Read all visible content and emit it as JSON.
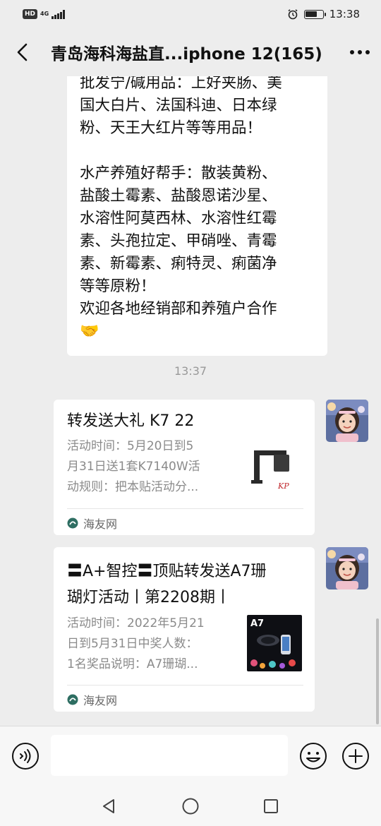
{
  "status_bar": {
    "hd": "HD",
    "network": "4G",
    "time": "13:38",
    "icons": [
      "hd-icon",
      "signal-icon",
      "alarm-icon",
      "battery-icon"
    ]
  },
  "header": {
    "title": "青岛海科海盐直...iphone 12(165)",
    "back_icon": "chevron-left-icon",
    "more_icon": "more-dots-icon"
  },
  "messages": {
    "text_message": {
      "lines_a": [
        "批发宁/碱用品：上好夹肠、美",
        "国大白片、法国科迪、日本绿",
        "粉、天王大红片等等用品！"
      ],
      "lines_b": [
        "水产养殖好帮手：散装黄粉、",
        "盐酸土霉素、盐酸恩诺沙星、",
        "水溶性阿莫西林、水溶性红霉",
        "素、头孢拉定、甲硝唑、青霉",
        "素、新霉素、痢特灵、痢菌净",
        "等等原粉！",
        "欢迎各地经销部和养殖户合作"
      ],
      "emoji": "🤝"
    },
    "time_label": "13:37",
    "cards": [
      {
        "title_lines": [
          "转发送大礼 K7 22"
        ],
        "desc_lines": [
          "活动时间：5月20日到5",
          "月31日送1套K7140W活",
          "动规则：把本贴活动分..."
        ],
        "source": "海友网",
        "thumb_text": "KP"
      },
      {
        "title_lines": [
          "〓A+智控〓顶贴转发送A7珊",
          "瑚灯活动丨第2208期丨"
        ],
        "desc_lines": [
          "活动时间：2022年5月21",
          "日到5月31日中奖人数：",
          "1名奖品说明：A7珊瑚..."
        ],
        "source": "海友网",
        "thumb_text": "A7"
      }
    ]
  },
  "input_bar": {
    "voice_icon": "voice-icon",
    "emoji_icon": "emoji-icon",
    "plus_icon": "plus-icon",
    "input_value": ""
  },
  "system_nav": {
    "icons": [
      "back-triangle-icon",
      "home-circle-icon",
      "recents-square-icon"
    ]
  },
  "colors": {
    "background": "#ededed",
    "bubble": "#ffffff",
    "muted_text": "#8a8a8a",
    "source_icon": "#2e6e62"
  }
}
